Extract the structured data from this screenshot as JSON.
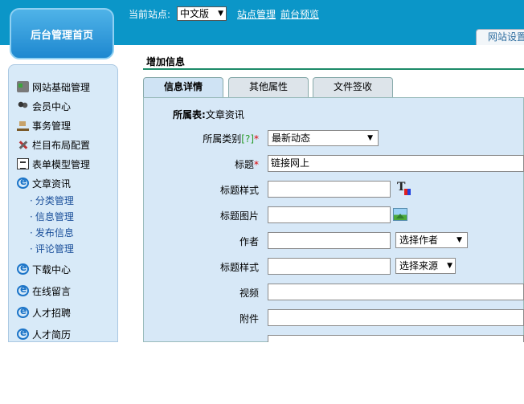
{
  "header": {
    "admin_home": "后台管理首页",
    "site_label": "当前站点:",
    "site_value": "中文版",
    "site_mgmt_link": "站点管理",
    "preview_link": "前台预览",
    "settings_tab": "网站设置"
  },
  "sidebar": {
    "items": [
      {
        "label": "网站基础管理",
        "icon": "house-icon"
      },
      {
        "label": "会员中心",
        "icon": "users-icon"
      },
      {
        "label": "事务管理",
        "icon": "desk-icon"
      },
      {
        "label": "栏目布局配置",
        "icon": "tools-icon"
      },
      {
        "label": "表单模型管理",
        "icon": "form-icon"
      },
      {
        "label": "文章资讯",
        "icon": "ie-icon"
      },
      {
        "label": "下载中心",
        "icon": "ie-icon"
      },
      {
        "label": "在线留言",
        "icon": "ie-icon"
      },
      {
        "label": "人才招聘",
        "icon": "ie-icon"
      },
      {
        "label": "人才简历",
        "icon": "ie-icon"
      }
    ],
    "subitems": [
      "分类管理",
      "信息管理",
      "发布信息",
      "评论管理"
    ],
    "bullet": "·"
  },
  "main": {
    "title": "增加信息",
    "tabs": [
      "信息详情",
      "其他属性",
      "文件签收"
    ],
    "belongs_label": "所属表:",
    "belongs_value": "文章资讯",
    "required_mark": "*",
    "help_mark": "[?]",
    "fields": {
      "category": {
        "label": "所属类别",
        "value": "最新动态"
      },
      "title": {
        "label": "标题",
        "value": "链接网上"
      },
      "title_style": {
        "label": "标题样式",
        "value": ""
      },
      "title_image": {
        "label": "标题图片",
        "value": ""
      },
      "author": {
        "label": "作者",
        "value": "",
        "select": "选择作者"
      },
      "source": {
        "label": "标题样式",
        "value": "",
        "select": "选择来源"
      },
      "video": {
        "label": "视频",
        "value": ""
      },
      "attachment": {
        "label": "附件",
        "value": ""
      }
    }
  },
  "colors": {
    "topbar": "#0b96c8",
    "sidebar_bg": "#d8eaf8",
    "panel_bg": "#d7e8f7",
    "rule": "#1c8a68",
    "required": "#dd0000"
  }
}
